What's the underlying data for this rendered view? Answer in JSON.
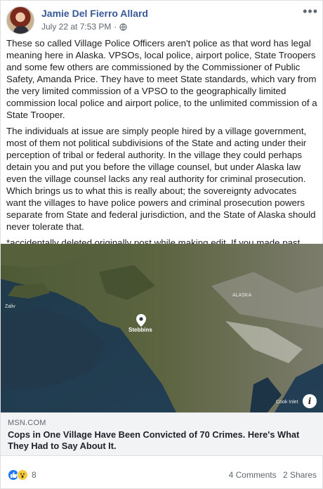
{
  "post": {
    "author": "Jamie Del Fierro Allard",
    "timestamp": "July 22 at 7:53 PM",
    "separator": "·",
    "more_menu": "•••",
    "paragraphs": [
      "These so called Village Police Officers aren't police as that word has legal meaning here in Alaska. VPSOs, local police, airport police, State Troopers and some few others are commissioned by the Commissioner of Public Safety, Amanda Price. They have to meet State standards, which vary from the very limited commission of a VPSO to the geographically limited commission local police and airport police, to the unlimited commission of a State Trooper.",
      "The individuals at issue are simply people hired by a village government, most of them not political subdivisions of the State and acting under their perception of tribal or federal authority. In the village they could perhaps detain you and put you before the village counsel, but under Alaska law even the village counsel lacks any real authority for criminal prosecution. Which brings us to what this is really about; the sovereignty advocates want the villages to have police powers and criminal prosecution powers separate from State and federal jurisdiction, and the State of Alaska should never tolerate that.",
      "*accidentally deleted originally post while making edit. If you made past comments please repost."
    ]
  },
  "map": {
    "pin_label": "Stebbins",
    "labels": [
      "Zaliv",
      "ALASKA",
      "Cook Inlet"
    ]
  },
  "link": {
    "source": "MSN.COM",
    "headline": "Cops in One Village Have Been Convicted of 70 Crimes. Here's What They Had to Say About It.",
    "info": "i"
  },
  "engagement": {
    "reaction_count": "8",
    "comments": "4 Comments",
    "shares": "2 Shares"
  }
}
